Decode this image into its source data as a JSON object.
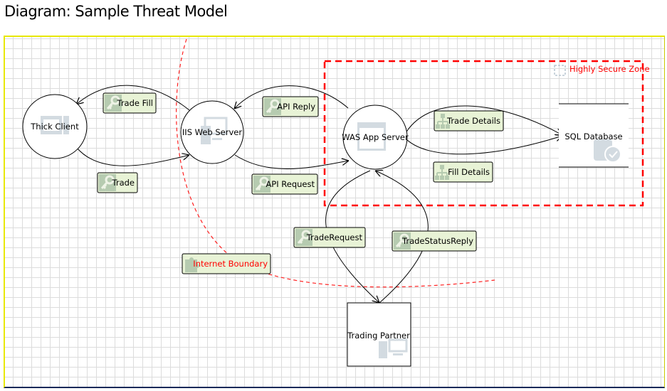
{
  "title": "Diagram: Sample Threat Model",
  "colors": {
    "boundary": "#ff0000",
    "label_bg": "#e8f3d6",
    "icon": "#a8b8c4"
  },
  "processes": [
    {
      "name": "Thick Client",
      "icon": "desktop-app-icon"
    },
    {
      "name": "IIS Web Server",
      "icon": "web-server-icon"
    },
    {
      "name": "WAS App Server",
      "icon": "app-window-icon"
    }
  ],
  "data_store": {
    "name": "SQL Database",
    "icon": "database-check-icon"
  },
  "external_entity": {
    "name": "Trading Partner",
    "icon": "computer-icon"
  },
  "flows": [
    {
      "label": "Trade Fill",
      "icon": "key-icon"
    },
    {
      "label": "Trade",
      "icon": "key-icon"
    },
    {
      "label": "API Reply",
      "icon": "key-icon"
    },
    {
      "label": "API Request",
      "icon": "key-icon"
    },
    {
      "label": "Trade Details",
      "icon": "hierarchy-icon"
    },
    {
      "label": "Fill Details",
      "icon": "hierarchy-icon"
    },
    {
      "label": "TradeRequest",
      "icon": "key-icon"
    },
    {
      "label": "TradeStatusReply",
      "icon": "key-icon"
    }
  ],
  "boundaries": [
    {
      "label": "Highly Secure Zone",
      "icon": "dashed-square-icon"
    },
    {
      "label": "Internet Boundary",
      "icon": "puzzle-icon"
    }
  ]
}
